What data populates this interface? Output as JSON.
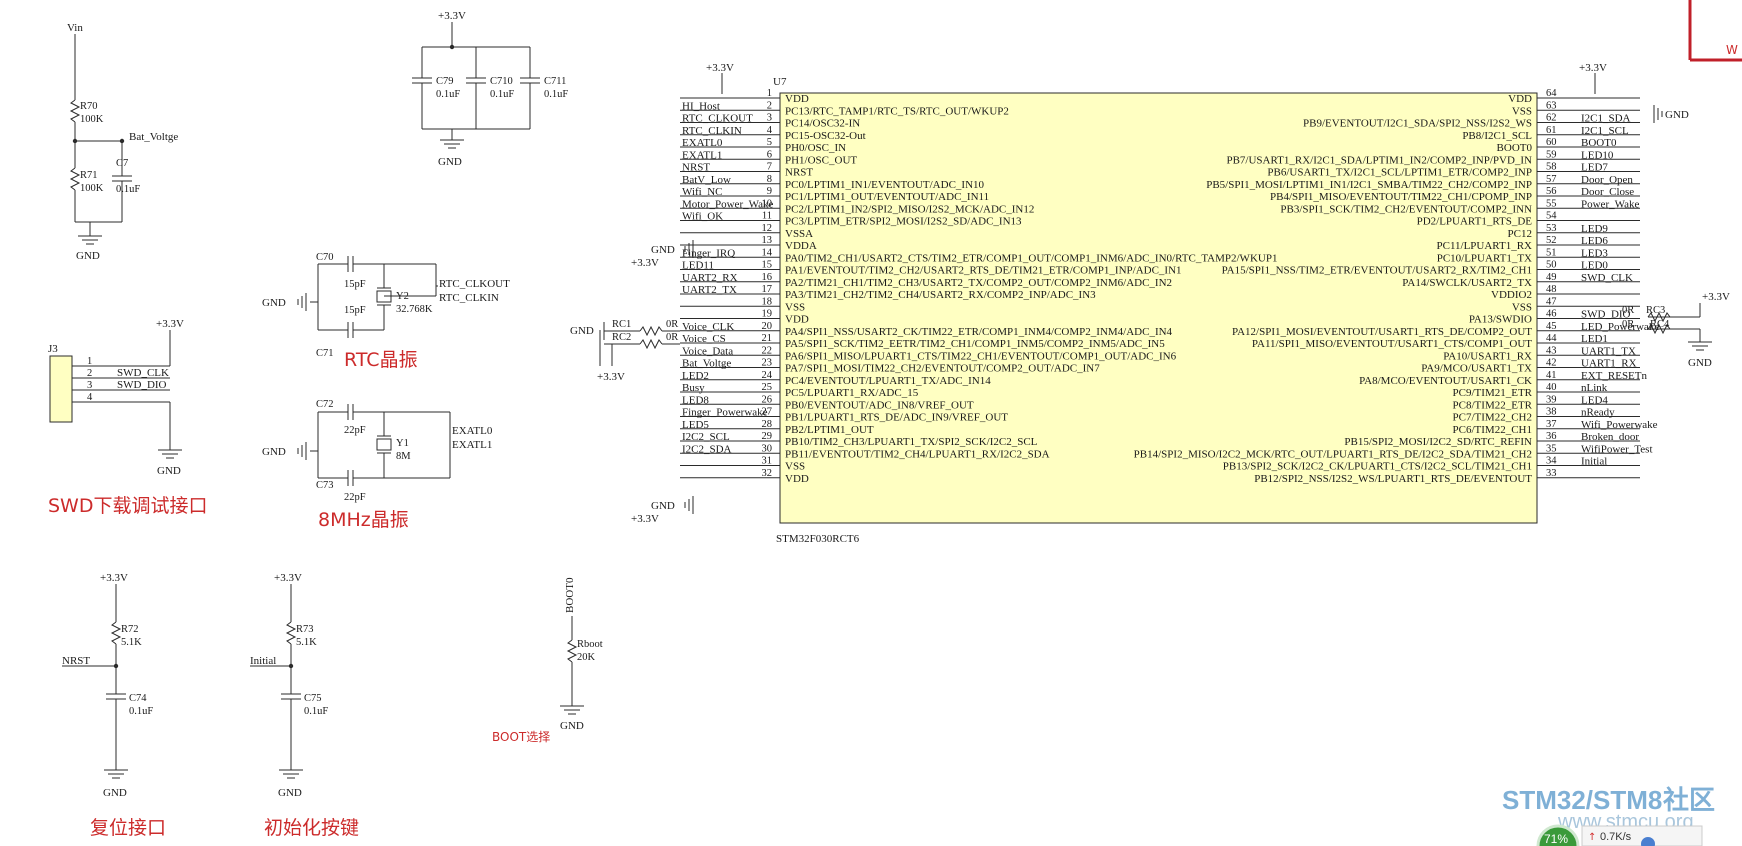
{
  "power": {
    "v33": "+3.3V",
    "vin": "Vin",
    "gnd": "GND"
  },
  "nets": {
    "bat_voltge": "Bat_Voltge",
    "swd_clk": "SWD_CLK",
    "swd_dio": "SWD_DIO",
    "rtc_clkout": "RTC_CLKOUT",
    "rtc_clkin": "RTC_CLKIN",
    "exatl0": "EXATL0",
    "exatl1": "EXATL1",
    "nrst": "NRST",
    "initial": "Initial",
    "boot0": "BOOT0"
  },
  "parts": {
    "r70": "R70",
    "r70_val": "100K",
    "r71": "R71",
    "r71_val": "100K",
    "c7": "C7",
    "c7_val": "0.1uF",
    "c79": "C79",
    "c710": "C710",
    "c711": "C711",
    "cap_val": "0.1uF",
    "c70": "C70",
    "c71": "C71",
    "c70_val": "15pF",
    "c71_val": "15pF",
    "y2": "Y2",
    "y2_val": "32.768K",
    "c72": "C72",
    "c73": "C73",
    "c72_val": "22pF",
    "c73_val": "22pF",
    "y1": "Y1",
    "y1_val": "8M",
    "j3": "J3",
    "r72": "R72",
    "r72_val": "5.1K",
    "c74": "C74",
    "c74_val": "0.1uF",
    "r73": "R73",
    "r73_val": "5.1K",
    "c75": "C75",
    "c75_val": "0.1uF",
    "rboot": "Rboot",
    "rboot_val": "20K",
    "rc1": "RC1",
    "rc2": "RC2",
    "rc1_val": "0R",
    "rc2_val": "0R",
    "rc3": "RC3",
    "rc4": "RC4",
    "rc3_val": "0R",
    "rc4_val": "0R"
  },
  "captions": {
    "rtc": "RTC晶振",
    "osc": "8MHz晶振",
    "swd": "SWD下载调试接口",
    "reset": "复位接口",
    "init": "初始化按键",
    "boot": "BOOT选择"
  },
  "mcu": {
    "designator": "U7",
    "part": "STM32F030RCT6",
    "left_pins": [
      {
        "num": "1",
        "name": "VDD",
        "net": "+3.3V"
      },
      {
        "num": "2",
        "name": "PC13/RTC_TAMP1/RTC_TS/RTC_OUT/WKUP2",
        "net": "HI_Host"
      },
      {
        "num": "3",
        "name": "PC14/OSC32-IN",
        "net": "RTC_CLKOUT"
      },
      {
        "num": "4",
        "name": "PC15-OSC32-Out",
        "net": "RTC_CLKIN"
      },
      {
        "num": "5",
        "name": "PH0/OSC_IN",
        "net": "EXATL0"
      },
      {
        "num": "6",
        "name": "PH1/OSC_OUT",
        "net": "EXATL1"
      },
      {
        "num": "7",
        "name": "NRST",
        "net": "NRST"
      },
      {
        "num": "8",
        "name": "PC0/LPTIM1_IN1/EVENTOUT/ADC_IN10",
        "net": "BatV_Low"
      },
      {
        "num": "9",
        "name": "PC1/LPTIM1_OUT/EVENTOUT/ADC_IN11",
        "net": "Wifi_NC"
      },
      {
        "num": "10",
        "name": "PC2/LPTIM1_IN2/SPI2_MISO/I2S2_MCK/ADC_IN12",
        "net": "Motor_Power_Wake"
      },
      {
        "num": "11",
        "name": "PC3/LPTIM_ETR/SPI2_MOSI/I2S2_SD/ADC_IN13",
        "net": "Wifi_OK"
      },
      {
        "num": "12",
        "name": "VSSA",
        "net": "GND"
      },
      {
        "num": "13",
        "name": "VDDA",
        "net": "+3.3V"
      },
      {
        "num": "14",
        "name": "PA0/TIM2_CH1/USART2_CTS/TIM2_ETR/COMP1_OUT/COMP1_INM6/ADC_IN0/RTC_TAMP2/WKUP1",
        "net": "Finger_IRQ"
      },
      {
        "num": "15",
        "name": "PA1/EVENTOUT/TIM2_CH2/USART2_RTS_DE/TIM21_ETR/COMP1_INP/ADC_IN1",
        "net": "LED11"
      },
      {
        "num": "16",
        "name": "PA2/TIM21_CH1/TIM2_CH3/USART2_TX/COMP2_OUT/COMP2_INM6/ADC_IN2",
        "net": "UART2_RX"
      },
      {
        "num": "17",
        "name": "PA3/TIM21_CH2/TIM2_CH4/USART2_RX/COMP2_INP/ADC_IN3",
        "net": "UART2_TX"
      },
      {
        "num": "18",
        "name": "VSS",
        "net": ""
      },
      {
        "num": "19",
        "name": "VDD",
        "net": ""
      },
      {
        "num": "20",
        "name": "PA4/SPI1_NSS/USART2_CK/TIM22_ETR/COMP1_INM4/COMP2_INM4/ADC_IN4",
        "net": "Voice_CLK"
      },
      {
        "num": "21",
        "name": "PA5/SPI1_SCK/TIM2_EETR/TIM2_CH1/COMP1_INM5/COMP2_INM5/ADC_IN5",
        "net": "Voice_CS"
      },
      {
        "num": "22",
        "name": "PA6/SPI1_MISO/LPUART1_CTS/TIM22_CH1/EVENTOUT/COMP1_OUT/ADC_IN6",
        "net": "Voice_Data"
      },
      {
        "num": "23",
        "name": "PA7/SPI1_MOSI/TIM22_CH2/EVENTOUT/COMP2_OUT/ADC_IN7",
        "net": "Bat_Voltge"
      },
      {
        "num": "24",
        "name": "PC4/EVENTOUT/LPUART1_TX/ADC_IN14",
        "net": "LED2"
      },
      {
        "num": "25",
        "name": "PC5/LPUART1_RX/ADC_15",
        "net": "Busy"
      },
      {
        "num": "26",
        "name": "PB0/EVENTOUT/ADC_IN8/VREF_OUT",
        "net": "LED8"
      },
      {
        "num": "27",
        "name": "PB1/LPUART1_RTS_DE/ADC_IN9/VREF_OUT",
        "net": "Finger_Powerwake"
      },
      {
        "num": "28",
        "name": "PB2/LPTIM1_OUT",
        "net": "LED5"
      },
      {
        "num": "29",
        "name": "PB10/TIM2_CH3/LPUART1_TX/SPI2_SCK/I2C2_SCL",
        "net": "I2C2_SCL"
      },
      {
        "num": "30",
        "name": "PB11/EVENTOUT/TIM2_CH4/LPUART1_RX/I2C2_SDA",
        "net": "I2C2_SDA"
      },
      {
        "num": "31",
        "name": "VSS",
        "net": "GND"
      },
      {
        "num": "32",
        "name": "VDD",
        "net": "+3.3V"
      }
    ],
    "right_pins": [
      {
        "num": "64",
        "name": "VDD",
        "net": "+3.3V"
      },
      {
        "num": "63",
        "name": "VSS",
        "net": "GND"
      },
      {
        "num": "62",
        "name": "PB9/EVENTOUT/I2C1_SDA/SPI2_NSS/I2S2_WS",
        "net": "I2C1_SDA"
      },
      {
        "num": "61",
        "name": "PB8/I2C1_SCL",
        "net": "I2C1_SCL"
      },
      {
        "num": "60",
        "name": "BOOT0",
        "net": "BOOT0"
      },
      {
        "num": "59",
        "name": "PB7/USART1_RX/I2C1_SDA/LPTIM1_IN2/COMP2_INP/PVD_IN",
        "net": "LED10"
      },
      {
        "num": "58",
        "name": "PB6/USART1_TX/I2C1_SCL/LPTIM1_ETR/COMP2_INP",
        "net": "LED7"
      },
      {
        "num": "57",
        "name": "PB5/SPI1_MOSI/LPTIM1_IN1/I2C1_SMBA/TIM22_CH2/COMP2_INP",
        "net": "Door_Open"
      },
      {
        "num": "56",
        "name": "PB4/SPI1_MISO/EVENTOUT/TIM22_CH1/CPOMP_INP",
        "net": "Door_Close"
      },
      {
        "num": "55",
        "name": "PB3/SPI1_SCK/TIM2_CH2/EVENTOUT/COMP2_INN",
        "net": "Power_Wake"
      },
      {
        "num": "54",
        "name": "PD2/LPUART1_RTS_DE",
        "net": ""
      },
      {
        "num": "53",
        "name": "PC12",
        "net": "LED9"
      },
      {
        "num": "52",
        "name": "PC11/LPUART1_RX",
        "net": "LED6"
      },
      {
        "num": "51",
        "name": "PC10/LPUART1_TX",
        "net": "LED3"
      },
      {
        "num": "50",
        "name": "PA15/SPI1_NSS/TIM2_ETR/EVENTOUT/USART2_RX/TIM2_CH1",
        "net": "LED0"
      },
      {
        "num": "49",
        "name": "PA14/SWCLK/USART2_TX",
        "net": "SWD_CLK"
      },
      {
        "num": "48",
        "name": "VDDIO2",
        "net": ""
      },
      {
        "num": "47",
        "name": "VSS",
        "net": ""
      },
      {
        "num": "46",
        "name": "PA13/SWDIO",
        "net": "SWD_DIO"
      },
      {
        "num": "45",
        "name": "PA12/SPI1_MOSI/EVENTOUT/USART1_RTS_DE/COMP2_OUT",
        "net": "LED_Powerwake"
      },
      {
        "num": "44",
        "name": "PA11/SPI1_MISO/EVENTOUT/USART1_CTS/COMP1_OUT",
        "net": "LED1"
      },
      {
        "num": "43",
        "name": "PA10/USART1_RX",
        "net": "UART1_TX"
      },
      {
        "num": "42",
        "name": "PA9/MCO/USART1_TX",
        "net": "UART1_RX"
      },
      {
        "num": "41",
        "name": "PA8/MCO/EVENTOUT/USART1_CK",
        "net": "EXT_RESETn"
      },
      {
        "num": "40",
        "name": "PC9/TIM21_ETR",
        "net": "nLink"
      },
      {
        "num": "39",
        "name": "PC8/TIM22_ETR",
        "net": "LED4"
      },
      {
        "num": "38",
        "name": "PC7/TIM22_CH2",
        "net": "nReady"
      },
      {
        "num": "37",
        "name": "PC6/TIM22_CH1",
        "net": "Wifi_Powerwake"
      },
      {
        "num": "36",
        "name": "PB15/SPI2_MOSI/I2C2_SD/RTC_REFIN",
        "net": "Broken_door"
      },
      {
        "num": "35",
        "name": "PB14/SPI2_MISO/I2C2_MCK/RTC_OUT/LPUART1_RTS_DE/I2C2_SDA/TIM21_CH2",
        "net": "WifiPower_Test"
      },
      {
        "num": "34",
        "name": "PB13/SPI2_SCK/I2C2_CK/LPUART1_CTS/I2C2_SCL/TIM21_CH1",
        "net": "Initial"
      },
      {
        "num": "33",
        "name": "PB12/SPI2_NSS/I2S2_WS/LPUART1_RTS_DE/EVENTOUT",
        "net": ""
      }
    ]
  },
  "swd_header_pins": [
    "1",
    "2",
    "3",
    "4"
  ],
  "watermark": {
    "brand1": "STM32/STM8",
    "brand2": "社区",
    "url": "www.stmcu.org",
    "percent": "71%",
    "speed": "0.7K/s",
    "corner": "W"
  }
}
